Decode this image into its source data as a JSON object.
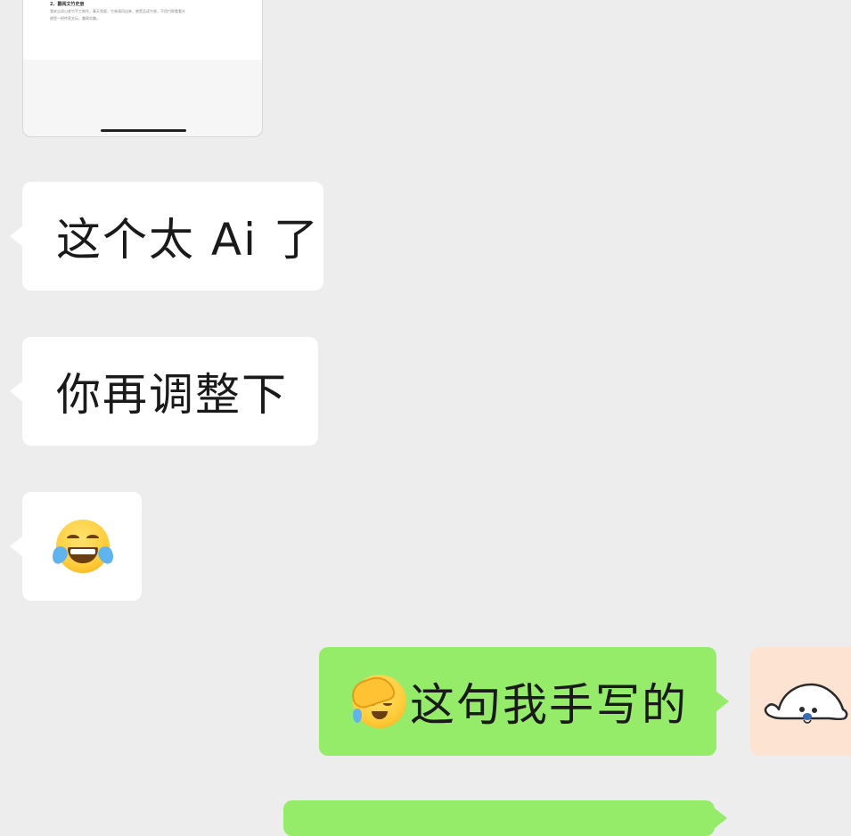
{
  "thumbnail": {
    "heading": "2、翻阅文竹史册",
    "line1": "我安吉深山老竹手工制作，春天到夏，竹林清风自来，感受品读竹香，不用付款看看头",
    "line2": "便是一把传家文玩，兼顾实趣。"
  },
  "messages": [
    {
      "side": "in",
      "text": "这个太 Ai 了"
    },
    {
      "side": "in",
      "text": "你再调整下"
    },
    {
      "side": "in",
      "emoji": "face-with-tears-of-joy"
    },
    {
      "side": "out",
      "emoji": "face-palm",
      "text": "这句我手写的"
    }
  ],
  "colors": {
    "chat_background": "#ededed",
    "incoming_bubble": "#ffffff",
    "outgoing_bubble": "#95ec69",
    "avatar_background": "#fde3d2"
  }
}
